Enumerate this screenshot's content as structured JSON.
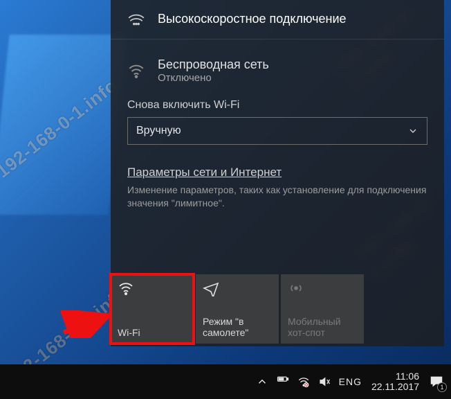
{
  "watermark": "192-168-0-1.info",
  "connections": [
    {
      "icon": "broadband-icon",
      "title": "Высокоскоростное подключение",
      "status": ""
    },
    {
      "icon": "wifi-icon",
      "title": "Беспроводная сеть",
      "status": "Отключено"
    }
  ],
  "reenable": {
    "label": "Снова включить Wi-Fi",
    "dropdown_value": "Вручную"
  },
  "settings_link": "Параметры сети и Интернет",
  "settings_desc": "Изменение параметров, таких как установление для подключения значения \"лимитное\".",
  "tiles": [
    {
      "name": "wifi-tile",
      "label": "Wi-Fi",
      "dim": false,
      "highlight": true
    },
    {
      "name": "airplane-tile",
      "label": "Режим \"в самолете\"",
      "dim": false,
      "highlight": false
    },
    {
      "name": "hotspot-tile",
      "label": "Мобильный хот-спот",
      "dim": true,
      "highlight": false
    }
  ],
  "tray": {
    "language": "ENG",
    "time": "11:06",
    "date": "22.11.2017",
    "notification_count": "1"
  }
}
